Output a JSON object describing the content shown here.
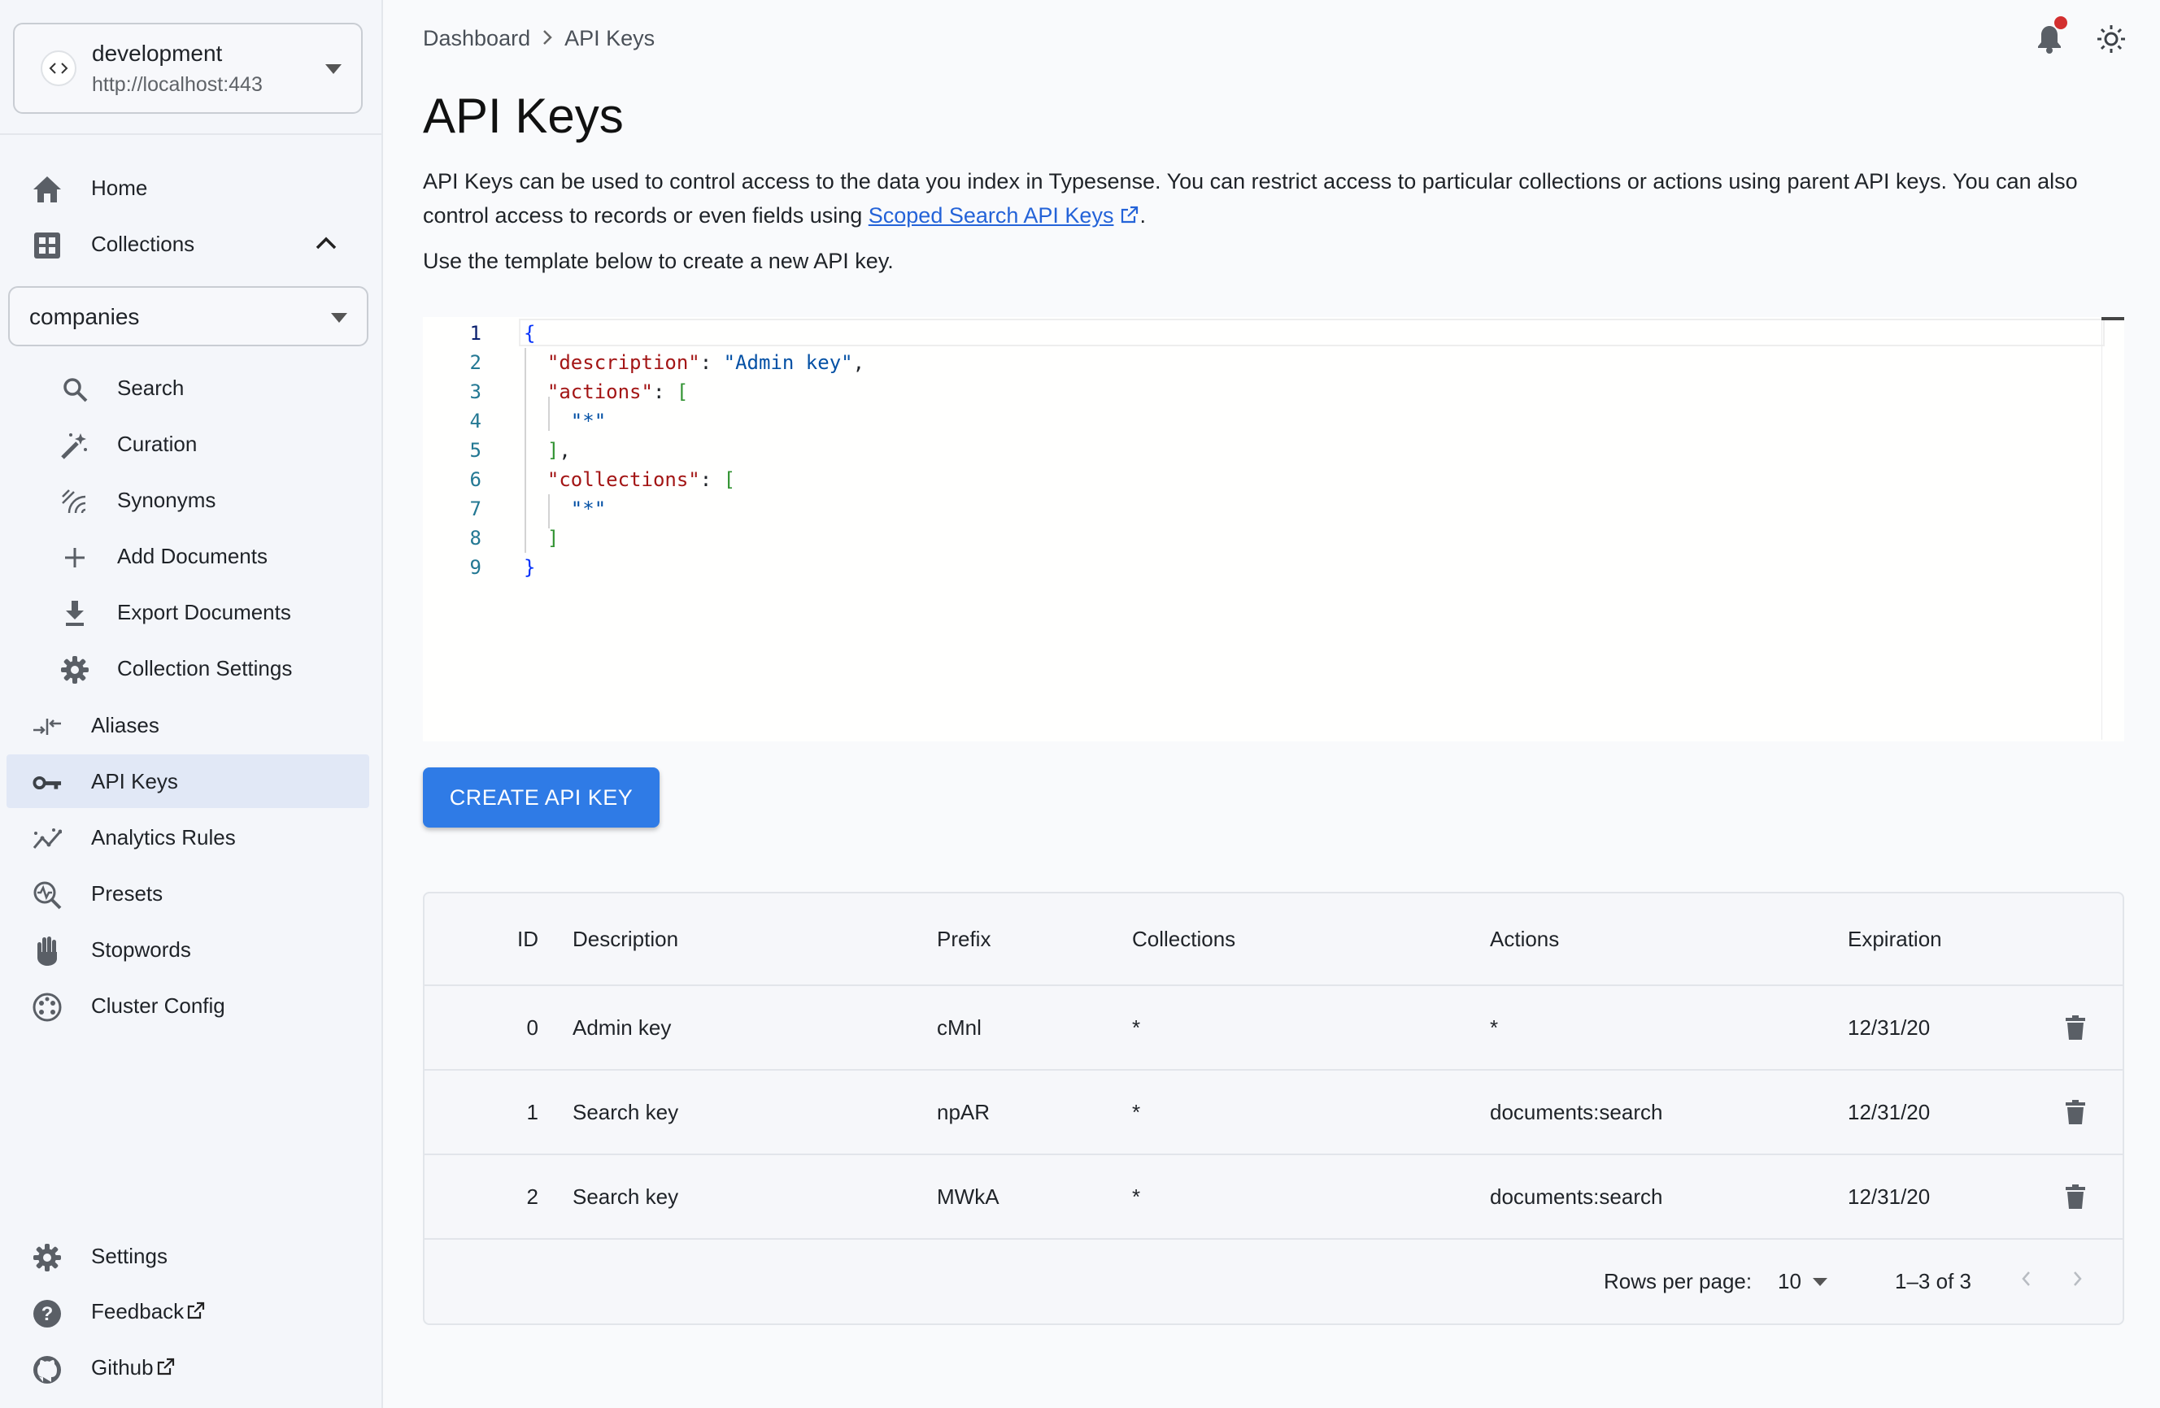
{
  "server": {
    "name": "development",
    "url": "http://localhost:443"
  },
  "nav": {
    "home": "Home",
    "collections": "Collections",
    "collection_selected": "companies",
    "sub": {
      "search": "Search",
      "curation": "Curation",
      "synonyms": "Synonyms",
      "add_documents": "Add Documents",
      "export_documents": "Export Documents",
      "collection_settings": "Collection Settings"
    },
    "aliases": "Aliases",
    "api_keys": "API Keys",
    "analytics_rules": "Analytics Rules",
    "presets": "Presets",
    "stopwords": "Stopwords",
    "cluster_config": "Cluster Config",
    "settings": "Settings",
    "feedback": "Feedback",
    "github": "Github"
  },
  "breadcrumb": {
    "root": "Dashboard",
    "current": "API Keys"
  },
  "page": {
    "title": "API Keys",
    "intro_1": "API Keys can be used to control access to the data you index in Typesense. You can restrict access to particular collections or actions using parent API keys. You can also control access to records or even fields using ",
    "intro_link": "Scoped Search API Keys",
    "intro_2": ".",
    "template_hint": "Use the template below to create a new API key."
  },
  "editor": {
    "line_numbers": [
      "1",
      "2",
      "3",
      "4",
      "5",
      "6",
      "7",
      "8",
      "9"
    ],
    "description_key": "\"description\"",
    "description_value": "\"Admin key\"",
    "actions_key": "\"actions\"",
    "actions_value": "\"*\"",
    "collections_key": "\"collections\"",
    "collections_value": "\"*\""
  },
  "create_button": "CREATE API KEY",
  "table": {
    "headers": {
      "id": "ID",
      "description": "Description",
      "prefix": "Prefix",
      "collections": "Collections",
      "actions": "Actions",
      "expiration": "Expiration"
    },
    "rows": [
      {
        "id": "0",
        "description": "Admin key",
        "prefix": "cMnl",
        "collections": "*",
        "actions": "*",
        "expiration": "12/31/20"
      },
      {
        "id": "1",
        "description": "Search key",
        "prefix": "npAR",
        "collections": "*",
        "actions": "documents:search",
        "expiration": "12/31/20"
      },
      {
        "id": "2",
        "description": "Search key",
        "prefix": "MWkA",
        "collections": "*",
        "actions": "documents:search",
        "expiration": "12/31/20"
      }
    ],
    "footer": {
      "rows_per_page_label": "Rows per page:",
      "rows_per_page_value": "10",
      "range": "1–3 of 3"
    }
  },
  "colors": {
    "accent": "#2f7be6",
    "active_nav_bg": "#e1e8f6",
    "notification_dot": "#d32f2f",
    "link": "#2463d8"
  },
  "icons": [
    "code-icon",
    "home-icon",
    "grid-icon",
    "search-icon",
    "wand-icon",
    "synonyms-icon",
    "plus-icon",
    "download-icon",
    "gear-icon",
    "alias-icon",
    "key-icon",
    "analytics-icon",
    "preset-icon",
    "hand-icon",
    "cluster-icon",
    "help-icon",
    "github-icon",
    "bell-icon",
    "sun-icon",
    "trash-icon",
    "external-link-icon"
  ]
}
